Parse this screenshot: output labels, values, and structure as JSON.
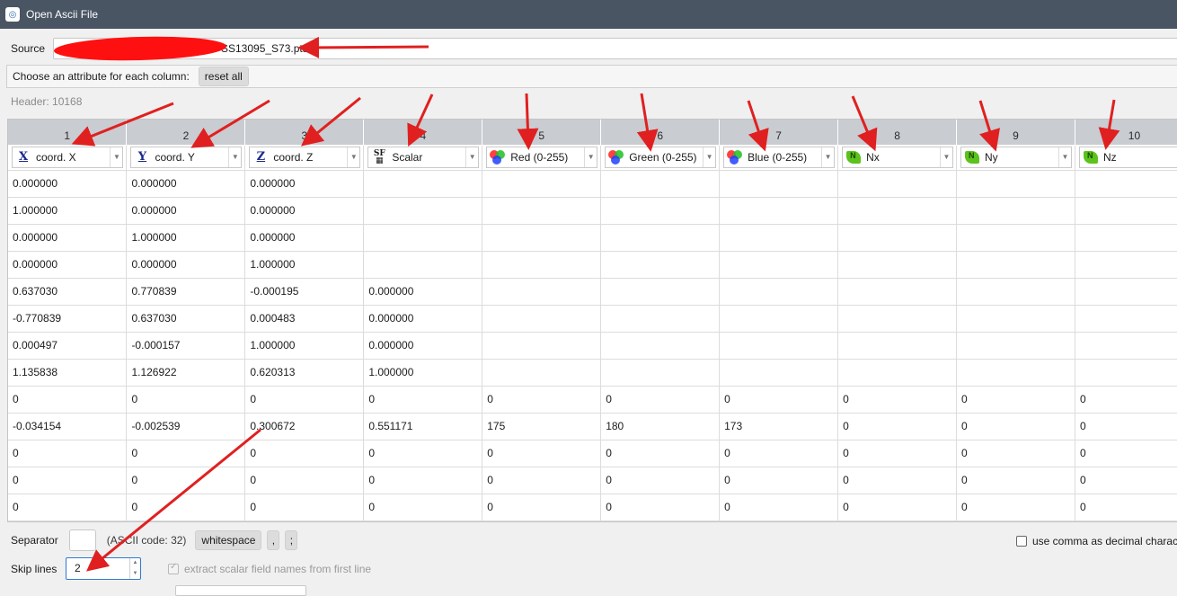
{
  "window": {
    "title": "Open Ascii File"
  },
  "source": {
    "label": "Source",
    "value": "SS13095_S73.pts"
  },
  "attributes": {
    "label": "Choose an attribute for each column:",
    "reset_label": "reset all"
  },
  "header_info": "Header: 10168",
  "columns": [
    {
      "num": "1",
      "attr": "coord. X",
      "icon": "x-coord-icon"
    },
    {
      "num": "2",
      "attr": "coord. Y",
      "icon": "y-coord-icon"
    },
    {
      "num": "3",
      "attr": "coord. Z",
      "icon": "z-coord-icon"
    },
    {
      "num": "4",
      "attr": "Scalar",
      "icon": "scalar-field-icon"
    },
    {
      "num": "5",
      "attr": "Red (0-255)",
      "icon": "rgb-icon"
    },
    {
      "num": "6",
      "attr": "Green (0-255)",
      "icon": "rgb-icon"
    },
    {
      "num": "7",
      "attr": "Blue (0-255)",
      "icon": "rgb-icon"
    },
    {
      "num": "8",
      "attr": "Nx",
      "icon": "normal-icon"
    },
    {
      "num": "9",
      "attr": "Ny",
      "icon": "normal-icon"
    },
    {
      "num": "10",
      "attr": "Nz",
      "icon": "normal-icon"
    }
  ],
  "rows": [
    [
      "0.000000",
      "0.000000",
      "0.000000",
      "",
      "",
      "",
      "",
      "",
      "",
      ""
    ],
    [
      "1.000000",
      "0.000000",
      "0.000000",
      "",
      "",
      "",
      "",
      "",
      "",
      ""
    ],
    [
      "0.000000",
      "1.000000",
      "0.000000",
      "",
      "",
      "",
      "",
      "",
      "",
      ""
    ],
    [
      "0.000000",
      "0.000000",
      "1.000000",
      "",
      "",
      "",
      "",
      "",
      "",
      ""
    ],
    [
      "0.637030",
      "0.770839",
      "-0.000195",
      "0.000000",
      "",
      "",
      "",
      "",
      "",
      ""
    ],
    [
      "-0.770839",
      "0.637030",
      "0.000483",
      "0.000000",
      "",
      "",
      "",
      "",
      "",
      ""
    ],
    [
      "0.000497",
      "-0.000157",
      "1.000000",
      "0.000000",
      "",
      "",
      "",
      "",
      "",
      ""
    ],
    [
      "1.135838",
      "1.126922",
      "0.620313",
      "1.000000",
      "",
      "",
      "",
      "",
      "",
      ""
    ],
    [
      "0",
      "0",
      "0",
      "0",
      "0",
      "0",
      "0",
      "0",
      "0",
      "0"
    ],
    [
      "-0.034154",
      "-0.002539",
      "0.300672",
      "0.551171",
      "175",
      "180",
      "173",
      "0",
      "0",
      "0"
    ],
    [
      "0",
      "0",
      "0",
      "0",
      "0",
      "0",
      "0",
      "0",
      "0",
      "0"
    ],
    [
      "0",
      "0",
      "0",
      "0",
      "0",
      "0",
      "0",
      "0",
      "0",
      "0"
    ],
    [
      "0",
      "0",
      "0",
      "0",
      "0",
      "0",
      "0",
      "0",
      "0",
      "0"
    ]
  ],
  "separator": {
    "label": "Separator",
    "value": "",
    "ascii_label": "(ASCII code: 32)",
    "whitespace_label": "whitespace",
    "comma_label": ",",
    "semicolon_label": ";"
  },
  "comma_decimal": {
    "label": "use comma as decimal character",
    "checked": false
  },
  "skip_lines": {
    "label": "Skip lines",
    "value": "2"
  },
  "extract_names": {
    "label": "extract scalar field names from first line",
    "checked": true,
    "enabled": false
  },
  "colors": {
    "titlebar": "#4a5563",
    "header_bg": "#c9ccd1",
    "arrow": "#e02020",
    "focus": "#2d7bd3"
  }
}
